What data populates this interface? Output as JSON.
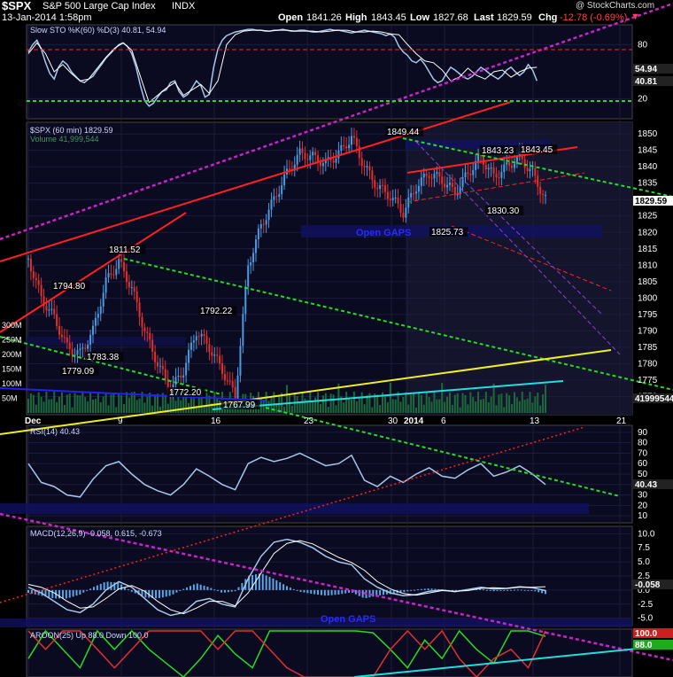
{
  "header": {
    "symbol": "$SPX",
    "name": "S&P 500 Large Cap Index",
    "exchange": "INDX",
    "watermark": "@ StockCharts.com",
    "date_time": "13-Jan-2014 1:58pm",
    "quote": {
      "open_label": "Open",
      "open": "1841.26",
      "high_label": "High",
      "high": "1843.45",
      "low_label": "Low",
      "low": "1827.68",
      "last_label": "Last",
      "last": "1829.59",
      "chg_label": "Chg",
      "chg": "-12.78 (-0.69%)"
    }
  },
  "colors": {
    "background": "#000000",
    "panel": "#0a0a20",
    "grid": "#1c1c3c",
    "trend_red": "#ff2020",
    "trend_green": "#22dd22",
    "trend_magenta": "#cc22cc",
    "trend_yellow": "#eeee22",
    "trend_cyan": "#22dddd",
    "price_up": "#4a9be0",
    "price_down": "#e03030",
    "indicator": "#a8c8e8"
  },
  "chart_data": [
    {
      "type": "line",
      "panel": "stochastic",
      "title": "Slow STO %K(60) %D(3) 40.81, 54.94",
      "ylim": [
        0,
        100
      ],
      "y_ticks": [
        20,
        80
      ],
      "last_values": [
        "54.94",
        "40.81"
      ],
      "series": [
        {
          "name": "%K(60)",
          "x": [
            0,
            5,
            10,
            15,
            20,
            25,
            30,
            35,
            40,
            45,
            50,
            55,
            60,
            65,
            70,
            75,
            80,
            85,
            90,
            95,
            100,
            105,
            110,
            115,
            120,
            125,
            130,
            135,
            140,
            145,
            150,
            155,
            160,
            165,
            170,
            175,
            180,
            185,
            190,
            195,
            200,
            205,
            210,
            215,
            220,
            225,
            230,
            235,
            240,
            245,
            250,
            255,
            260,
            265,
            270,
            275,
            280,
            285,
            290,
            295,
            300,
            305,
            310,
            315,
            320,
            325,
            330,
            335,
            340,
            345,
            350,
            355,
            360,
            365,
            370,
            375,
            380,
            385,
            390,
            395,
            400,
            405,
            410,
            415,
            420,
            425,
            430,
            435,
            440,
            445,
            450,
            455,
            460,
            465,
            470,
            475,
            480,
            485,
            490,
            495,
            500,
            505,
            510,
            515,
            520,
            525,
            530,
            535,
            540,
            545,
            550,
            555,
            560,
            565,
            570,
            575,
            580,
            585,
            590
          ],
          "values": [
            72,
            80,
            85,
            75,
            60,
            48,
            42,
            55,
            62,
            58,
            50,
            45,
            40,
            38,
            42,
            45,
            52,
            58,
            65,
            70,
            75,
            80,
            82,
            78,
            70,
            55,
            35,
            18,
            12,
            15,
            22,
            28,
            30,
            38,
            40,
            28,
            22,
            25,
            32,
            40,
            35,
            22,
            25,
            55,
            75,
            85,
            90,
            92,
            94,
            95,
            96,
            97,
            97,
            96,
            96,
            95,
            95,
            96,
            96,
            97,
            96,
            95,
            95,
            96,
            96,
            95,
            94,
            94,
            95,
            96,
            97,
            96,
            96,
            95,
            94,
            93,
            94,
            95,
            96,
            95,
            94,
            93,
            92,
            90,
            92,
            88,
            78,
            72,
            68,
            62,
            60,
            64,
            58,
            50,
            42,
            38,
            40,
            48,
            55,
            52,
            48,
            44,
            42,
            45,
            50,
            55,
            52,
            48,
            45,
            42,
            46,
            52,
            55,
            50,
            46,
            50,
            58,
            52,
            40
          ]
        },
        {
          "name": "%D(3)",
          "x": [
            0,
            10,
            20,
            30,
            40,
            50,
            60,
            70,
            80,
            90,
            100,
            110,
            120,
            130,
            140,
            150,
            160,
            170,
            180,
            190,
            200,
            210,
            220,
            230,
            240,
            250,
            260,
            270,
            280,
            290,
            300,
            310,
            320,
            330,
            340,
            350,
            360,
            370,
            380,
            390,
            400,
            410,
            420,
            430,
            440,
            450,
            460,
            470,
            480,
            490,
            500,
            510,
            520,
            530,
            540,
            550,
            560,
            570,
            580,
            590
          ],
          "values": [
            70,
            82,
            70,
            50,
            58,
            48,
            40,
            42,
            54,
            66,
            76,
            82,
            74,
            45,
            16,
            24,
            32,
            38,
            24,
            30,
            36,
            26,
            40,
            80,
            91,
            95,
            96,
            96,
            95,
            96,
            96,
            95,
            95,
            95,
            94,
            95,
            96,
            96,
            94,
            94,
            95,
            94,
            92,
            91,
            80,
            70,
            62,
            60,
            52,
            40,
            44,
            54,
            46,
            42,
            50,
            52,
            44,
            50,
            54,
            55
          ]
        }
      ]
    },
    {
      "type": "candlestick",
      "panel": "price",
      "title": "$SPX (60 min) 1829.59",
      "volume_label": "Volume 41,999,544",
      "ylim": [
        1765,
        1853
      ],
      "y_ticks": [
        1770,
        1775,
        1780,
        1785,
        1790,
        1795,
        1800,
        1805,
        1810,
        1815,
        1820,
        1825,
        1830,
        1835,
        1840,
        1845,
        1850
      ],
      "x_ticks": [
        "Dec",
        "9",
        "16",
        "23",
        "30",
        "2014",
        "6",
        "13",
        "21"
      ],
      "volume_ticks": [
        "300M",
        "250M",
        "200M",
        "150M",
        "100M",
        "50M"
      ],
      "last_price_label": "1829.59",
      "last_volume_label": "41999544",
      "annotations": [
        "1849.44",
        "1843.23",
        "1843.45",
        "1830.30",
        "1825.73",
        "1811.52",
        "1794.80",
        "1792.22",
        "1783.38",
        "1779.09",
        "1772.20",
        "1767.99",
        "Open GAPS"
      ],
      "close_path": {
        "x": [
          0,
          15,
          30,
          45,
          60,
          75,
          90,
          105,
          120,
          135,
          150,
          165,
          180,
          195,
          210,
          225,
          240,
          255,
          270,
          285,
          300,
          315,
          330,
          345,
          360,
          375,
          390,
          405,
          420,
          435,
          450,
          465,
          480,
          495,
          510,
          525,
          540,
          555,
          570,
          585,
          600
        ],
        "values": [
          1812,
          1800,
          1794,
          1785,
          1783,
          1790,
          1805,
          1811,
          1803,
          1790,
          1780,
          1772,
          1778,
          1790,
          1785,
          1778,
          1770,
          1810,
          1822,
          1830,
          1838,
          1844,
          1843,
          1841,
          1844,
          1849,
          1840,
          1834,
          1831,
          1826,
          1834,
          1838,
          1836,
          1832,
          1838,
          1843,
          1837,
          1840,
          1843,
          1838,
          1830
        ]
      }
    },
    {
      "type": "line",
      "panel": "rsi",
      "title": "RSI(14) 40.43",
      "ylim": [
        5,
        95
      ],
      "y_ticks": [
        10,
        20,
        30,
        40,
        50,
        60,
        70,
        80,
        90
      ],
      "last_value": "40.43",
      "series": [
        {
          "name": "RSI(14)",
          "x": [
            0,
            15,
            30,
            45,
            60,
            75,
            90,
            105,
            120,
            135,
            150,
            165,
            180,
            195,
            210,
            225,
            240,
            255,
            270,
            285,
            300,
            315,
            330,
            345,
            360,
            375,
            390,
            405,
            420,
            435,
            450,
            465,
            480,
            495,
            510,
            525,
            540,
            555,
            570,
            585,
            600
          ],
          "values": [
            60,
            42,
            38,
            30,
            28,
            45,
            58,
            62,
            50,
            40,
            34,
            30,
            40,
            55,
            48,
            40,
            35,
            60,
            66,
            62,
            65,
            70,
            64,
            58,
            60,
            68,
            44,
            38,
            48,
            42,
            50,
            56,
            48,
            46,
            54,
            60,
            48,
            52,
            58,
            50,
            40
          ]
        }
      ]
    },
    {
      "type": "bar",
      "panel": "macd",
      "title": "MACD(12,26,9) -0.058, 0.615, -0.673",
      "ylim": [
        -6,
        11
      ],
      "y_ticks": [
        "10.0",
        "7.5",
        "5.0",
        "2.5",
        "0.0",
        "-2.5",
        "-5.0"
      ],
      "last_value": "-0.058",
      "annotations": [
        "Open GAPS"
      ],
      "series": [
        {
          "name": "MACD",
          "x": [
            0,
            15,
            30,
            45,
            60,
            75,
            90,
            105,
            120,
            135,
            150,
            165,
            180,
            195,
            210,
            225,
            240,
            255,
            270,
            285,
            300,
            315,
            330,
            345,
            360,
            375,
            390,
            405,
            420,
            435,
            450,
            465,
            480,
            495,
            510,
            525,
            540,
            555,
            570,
            585,
            600
          ],
          "values": [
            0.5,
            -0.5,
            -2.0,
            -3.5,
            -4.0,
            -2.5,
            0.0,
            1.5,
            0.5,
            -1.5,
            -3.5,
            -4.5,
            -4.0,
            -2.0,
            -1.5,
            -2.5,
            -3.0,
            2.0,
            6.0,
            8.5,
            9.0,
            8.5,
            7.5,
            6.0,
            5.0,
            4.5,
            2.0,
            0.5,
            -0.5,
            -1.0,
            -0.8,
            -0.2,
            0.0,
            -0.3,
            0.1,
            0.5,
            0.2,
            0.3,
            0.6,
            0.4,
            -0.1
          ]
        },
        {
          "name": "Signal",
          "x": [
            0,
            15,
            30,
            45,
            60,
            75,
            90,
            105,
            120,
            135,
            150,
            165,
            180,
            195,
            210,
            225,
            240,
            255,
            270,
            285,
            300,
            315,
            330,
            345,
            360,
            375,
            390,
            405,
            420,
            435,
            450,
            465,
            480,
            495,
            510,
            525,
            540,
            555,
            570,
            585,
            600
          ],
          "values": [
            1.0,
            0.5,
            -0.5,
            -2.0,
            -3.2,
            -3.0,
            -1.5,
            0.2,
            0.8,
            -0.2,
            -2.0,
            -3.5,
            -4.2,
            -3.2,
            -2.0,
            -2.0,
            -2.8,
            -0.5,
            3.0,
            6.5,
            8.3,
            8.8,
            8.2,
            7.0,
            5.8,
            4.9,
            3.5,
            1.5,
            0.2,
            -0.6,
            -0.9,
            -0.5,
            -0.1,
            -0.2,
            -0.1,
            0.3,
            0.4,
            0.3,
            0.5,
            0.5,
            0.6
          ]
        }
      ]
    },
    {
      "type": "line",
      "panel": "aroon",
      "title": "AROON(25) Up 88.0 Down 100.0",
      "ylim": [
        0,
        100
      ],
      "last_values": [
        "100.0",
        "88.0"
      ],
      "series": [
        {
          "name": "Up",
          "x": [
            0,
            20,
            40,
            60,
            80,
            100,
            120,
            140,
            160,
            180,
            200,
            220,
            240,
            260,
            280,
            300,
            320,
            340,
            360,
            380,
            400,
            420,
            440,
            460,
            480,
            500,
            520,
            540,
            560,
            580,
            600
          ],
          "values": [
            40,
            100,
            60,
            20,
            100,
            60,
            100,
            60,
            30,
            0,
            40,
            90,
            50,
            20,
            100,
            100,
            100,
            100,
            100,
            100,
            96,
            60,
            20,
            80,
            40,
            100,
            60,
            30,
            100,
            100,
            88
          ]
        },
        {
          "name": "Down",
          "x": [
            0,
            20,
            40,
            60,
            80,
            100,
            120,
            140,
            160,
            180,
            200,
            220,
            240,
            260,
            280,
            300,
            320,
            340,
            360,
            380,
            400,
            420,
            440,
            460,
            480,
            500,
            520,
            540,
            560,
            580,
            600
          ],
          "values": [
            100,
            60,
            100,
            100,
            60,
            20,
            60,
            100,
            100,
            100,
            100,
            60,
            100,
            100,
            60,
            20,
            0,
            0,
            0,
            0,
            0,
            60,
            100,
            60,
            100,
            40,
            0,
            40,
            60,
            20,
            100
          ]
        }
      ]
    }
  ]
}
